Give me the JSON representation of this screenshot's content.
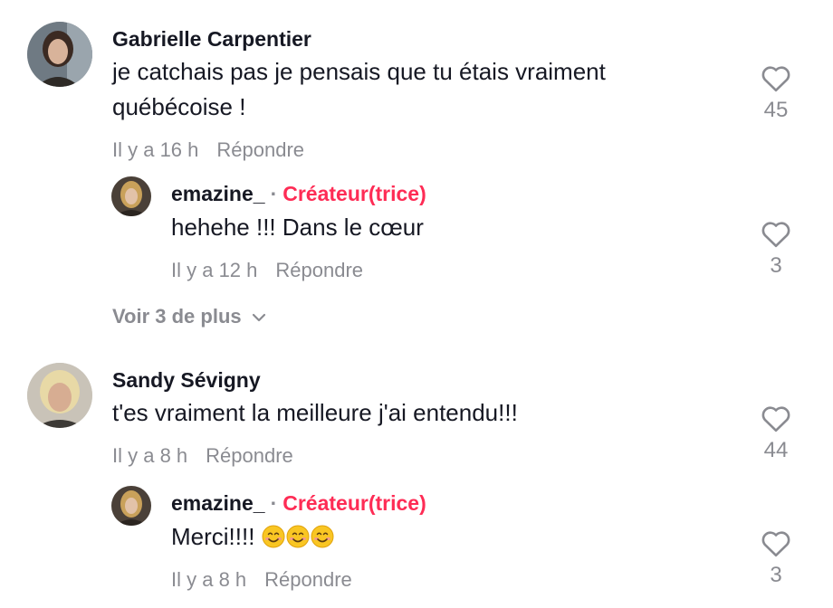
{
  "comments": [
    {
      "author": "Gabrielle Carpentier",
      "text": "je catchais pas je pensais que tu étais vraiment québécoise !",
      "time": "Il y a 16 h",
      "reply_label": "Répondre",
      "likes": "45",
      "reply": {
        "author": "emazine_",
        "separator": "·",
        "badge": "Créateur(trice)",
        "text": "hehehe !!! Dans le cœur",
        "time": "Il y a 12 h",
        "reply_label": "Répondre",
        "likes": "3"
      },
      "more_replies": "Voir 3 de plus"
    },
    {
      "author": "Sandy Sévigny",
      "text": "t'es vraiment la meilleure j'ai entendu!!!",
      "time": "Il y a 8 h",
      "reply_label": "Répondre",
      "likes": "44",
      "reply": {
        "author": "emazine_",
        "separator": "·",
        "badge": "Créateur(trice)",
        "text": "Merci!!!!",
        "emoji": "😊😊😊",
        "time": "Il y a 8 h",
        "reply_label": "Répondre",
        "likes": "3"
      }
    }
  ],
  "icons": {
    "like": "heart-outline-icon",
    "expand": "chevron-down-icon",
    "emoji": "smiling-face-icon"
  },
  "colors": {
    "text": "#161823",
    "secondary": "#8a8b91",
    "creator_badge": "#fe2c55"
  }
}
